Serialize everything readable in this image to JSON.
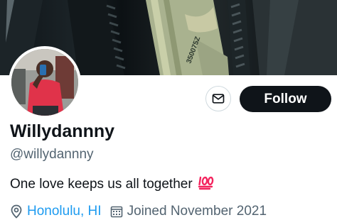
{
  "header": {
    "banner_image": "banner-photo",
    "avatar_image": "profile-photo"
  },
  "actions": {
    "message_icon": "mail-icon",
    "follow_label": "Follow"
  },
  "profile": {
    "display_name": "Willydannny",
    "handle": "@willydannny",
    "bio": "One love keeps us all together",
    "bio_emoji": "100-emoji",
    "location": "Honolulu, HI",
    "joined": "Joined November 2021"
  },
  "colors": {
    "accent": "#1d9bf0",
    "secondary_text": "#536471",
    "follow_bg": "#0f1419",
    "emoji_red": "#f4245e"
  }
}
